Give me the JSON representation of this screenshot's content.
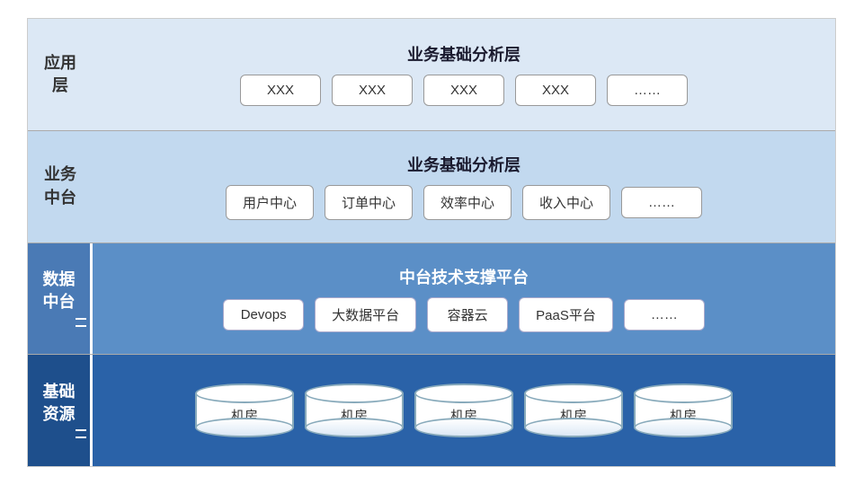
{
  "diagram": {
    "rows": [
      {
        "id": "app",
        "label": "应用\n层",
        "title": "业务基础分析层",
        "type": "rect",
        "items": [
          "XXX",
          "XXX",
          "XXX",
          "XXX",
          "……"
        ]
      },
      {
        "id": "biz",
        "label": "业务\n中台",
        "title": "业务基础分析层",
        "type": "rect",
        "items": [
          "用户中心",
          "订单中心",
          "效率中心",
          "收入中心",
          "……"
        ]
      },
      {
        "id": "data",
        "label": "数据\n中台",
        "title": "中台技术支撑平台",
        "type": "rect",
        "items": [
          "Devops",
          "大数据平台",
          "容器云",
          "PaaS平台",
          "……"
        ]
      },
      {
        "id": "infra",
        "label": "基础\n资源",
        "title": null,
        "type": "cylinder",
        "items": [
          "机房",
          "机房",
          "机房",
          "机房",
          "机房"
        ]
      }
    ]
  }
}
